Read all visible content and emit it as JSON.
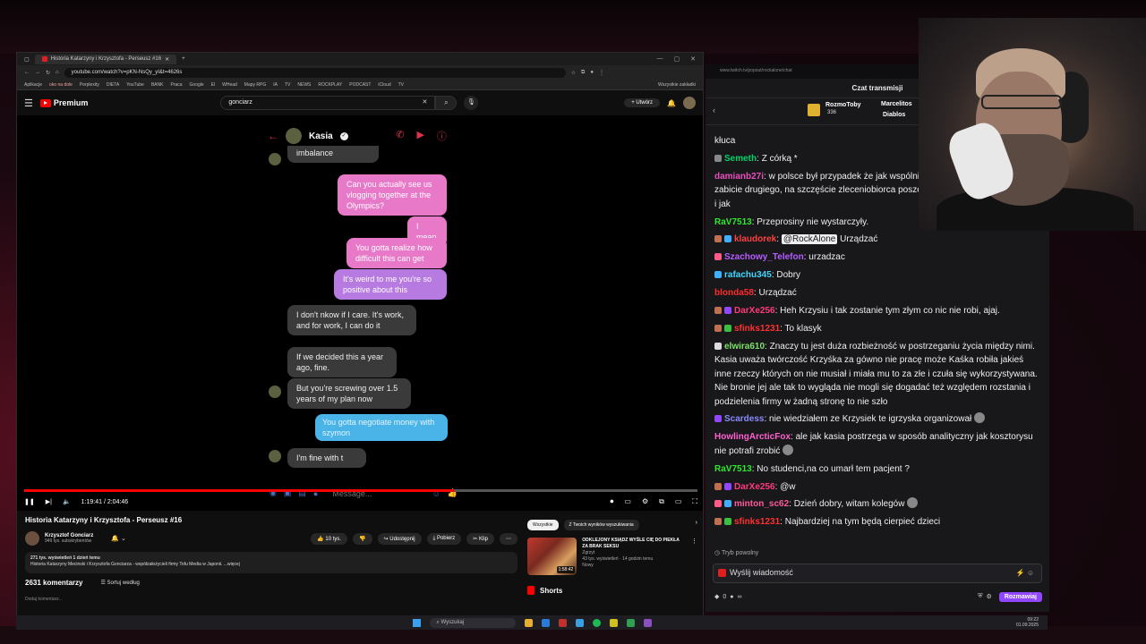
{
  "browser": {
    "tab_title": "Historia Katarzyny i Krzysztofa - Perseusz #16",
    "url": "youtube.com/watch?v=pKN-NsQy_yI&t=4626s",
    "bookmarks": [
      "Aplikacje",
      "oko na dole",
      "Perplexity",
      "DIETA",
      "YouTube",
      "BANK",
      "Praca",
      "Google",
      "El",
      "WHead",
      "Mapy RPG",
      "IA",
      "TV",
      "NEWS",
      "ROCKPLAY",
      "PODCAST",
      "iCloud",
      "TV",
      "Wszystkie zakładki"
    ]
  },
  "youtube": {
    "logo": "Premium",
    "search_value": "gonciarz",
    "create_label": "Utwórz",
    "video_title": "Historia Katarzyny i Krzysztofa - Perseusz #16",
    "channel_name": "Krzysztof Gonciarz",
    "subscribers": "949 tys. subskrybentów",
    "likes": "10 tys.",
    "share": "Udostępnij",
    "download": "Pobierz",
    "clip": "Klip",
    "desc_line1": "271 tys. wyświetleń  1 dzień temu",
    "desc_line2": "Historia Katarzyny Mecinski i Krzysztofa Gonciarza - współzałożycieli firmy Tofu Media w Japonii. ...więcej",
    "comments_count": "2631 komentarzy",
    "sort_label": "Sortuj według",
    "add_comment": "Dodaj komentarz...",
    "chips": [
      "Wszystkie",
      "Z Twoich wyników wyszukiwania"
    ],
    "rec": {
      "duration": "1:58:42",
      "title": "ODKLEJONY KSIĄDZ WYŚLE CIĘ DO PIEKŁA ZA BRAK SEKSU",
      "channel": "Zgrzyt",
      "meta": "43 tys. wyświetleń · 14 godzin temu",
      "badge": "Nowy"
    },
    "shorts": "Shorts",
    "time": "1:19:41 / 2:04:46",
    "progress": 0.638
  },
  "dm": {
    "contact": "Kasia",
    "messages": [
      {
        "side": "left",
        "text": "imbalance"
      },
      {
        "side": "pink",
        "text": "Can you actually see us vlogging together at the Olympics?"
      },
      {
        "side": "pink",
        "text": "I mean"
      },
      {
        "side": "pink",
        "text": "You gotta realize how difficult this can get"
      },
      {
        "side": "purple",
        "text": "It's weird to me you're so positive about this"
      },
      {
        "side": "left",
        "text": "I don't nkow if I care. It's work, and for work, I can do it"
      },
      {
        "side": "left",
        "text": "If we decided this a year ago, fine."
      },
      {
        "side": "left",
        "text": "But you're screwing over 1.5 years of my plan now"
      },
      {
        "side": "blue",
        "text": "You gotta negotiate money with szymon"
      },
      {
        "side": "left",
        "text": "I'm fine with t"
      }
    ],
    "compose_placeholder": "Message..."
  },
  "twitch": {
    "url": "www.twitch.tv/popout/rockalone/chat",
    "title": "Czat transmisji",
    "gifter1": "RozmoToby",
    "gifter1_count": "336",
    "gifter2": "Marcelitos",
    "gifter3": "Diablos",
    "slowmode": "Tryb powolny",
    "input_placeholder": "Wyślij wiadomość",
    "points": "0",
    "chat_button": "Rozmawiaj",
    "messages": [
      {
        "user": "",
        "color": "#efeff1",
        "text": "kłuca"
      },
      {
        "user": "Semeth",
        "color": "#00d26a",
        "text": "Z córką *"
      },
      {
        "user": "damianb27i",
        "color": "#e84fbb",
        "text": "w polsce był przypadek że jak wspólnicy się pokłócili to jeden zlecił zabicie drugiego, na szczęście zleceniobiorca poszedł do drugiego i powiedział co i jak"
      },
      {
        "user": "RaV7513",
        "color": "#2ee82e",
        "text": "Przeprosiny nie wystarczyły."
      },
      {
        "user": "klaudorek",
        "color": "#ff4040",
        "mention": "@RockAlone",
        "text": "Urządzać"
      },
      {
        "user": "Szachowy_Telefon",
        "color": "#b45cff",
        "text": "urzadzac"
      },
      {
        "user": "rafachu345",
        "color": "#3fd7ff",
        "text": "Dobry"
      },
      {
        "user": "blonda58",
        "color": "#ff2a2a",
        "text": "Urządzać"
      },
      {
        "user": "DarXe256",
        "color": "#ff3a7a",
        "text": "Heh Krzysiu i tak zostanie tym złym co nic nie robi, ajaj."
      },
      {
        "user": "sfinks1231",
        "color": "#ff3030",
        "text": "To klasyk"
      },
      {
        "user": "elwira610",
        "color": "#7de06a",
        "text": "Znaczy tu jest duża rozbieżność w postrzeganiu życia między nimi. Kasia uważa twórczość Krzyśka za gówno nie pracę może Kaśka robiła jakieś inne rzeczy których on nie musiał i miała mu to za złe i czuła się wykorzystywana. Nie bronie jej ale tak to wygląda nie mogli się dogadać też względem rozstania i podzielenia firmy w żadną stronę to nie szło"
      },
      {
        "user": "Scardess",
        "color": "#8a8aff",
        "text": "nie wiedziałem ze Krzysiek te igrzyska organizował"
      },
      {
        "user": "HowlingArcticFox",
        "color": "#ff5fd0",
        "text": "ale jak kasia postrzega w sposób analityczny jak kosztorysu nie potrafi zrobić"
      },
      {
        "user": "RaV7513",
        "color": "#2ee82e",
        "text": "No studenci,na co umarł tem pacjent ?"
      },
      {
        "user": "DarXe256",
        "color": "#ff3a7a",
        "text": "@w"
      },
      {
        "user": "minton_sc62",
        "color": "#ff5a9a",
        "text": "Dzień dobry, witam kolegów"
      },
      {
        "user": "sfinks1231",
        "color": "#ff3030",
        "text": "Najbardziej na tym będą cierpieć dzieci"
      }
    ]
  },
  "taskbar": {
    "search": "Wyszukaj",
    "time": "09:22",
    "date": "01.09.2025"
  }
}
